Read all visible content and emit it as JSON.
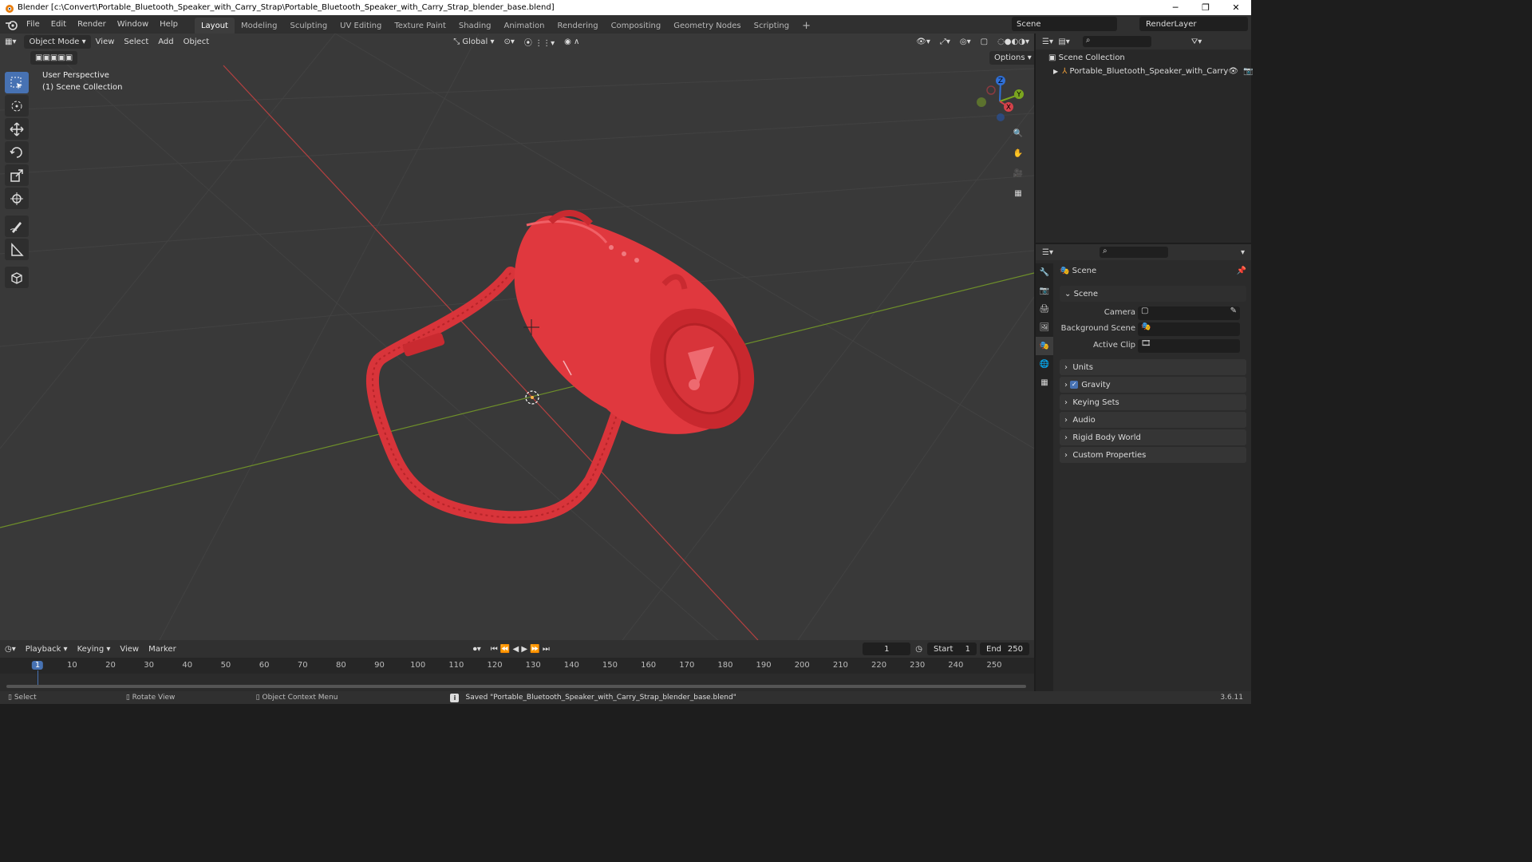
{
  "window": {
    "title": "Blender [c:\\Convert\\Portable_Bluetooth_Speaker_with_Carry_Strap\\Portable_Bluetooth_Speaker_with_Carry_Strap_blender_base.blend]",
    "min": "─",
    "max": "❐",
    "close": "✕"
  },
  "menus": [
    "File",
    "Edit",
    "Render",
    "Window",
    "Help"
  ],
  "workspaces": [
    "Layout",
    "Modeling",
    "Sculpting",
    "UV Editing",
    "Texture Paint",
    "Shading",
    "Animation",
    "Rendering",
    "Compositing",
    "Geometry Nodes",
    "Scripting"
  ],
  "scene_name": "Scene",
  "render_layer": "RenderLayer",
  "viewport": {
    "mode": "Object Mode",
    "menus": [
      "View",
      "Select",
      "Add",
      "Object"
    ],
    "transform": "Global",
    "options": "Options",
    "perspective": "User Perspective",
    "collection": "(1) Scene Collection",
    "gizmo": {
      "z": "Z",
      "y": "Y",
      "x": "X"
    },
    "object_color": "#e0383e"
  },
  "outliner": {
    "root": "Scene Collection",
    "object": "Portable_Bluetooth_Speaker_with_Carry"
  },
  "properties": {
    "header": "Scene",
    "section": "Scene",
    "fields": [
      {
        "label": "Camera"
      },
      {
        "label": "Background Scene"
      },
      {
        "label": "Active Clip"
      }
    ],
    "panels": [
      "Units",
      "Gravity",
      "Keying Sets",
      "Audio",
      "Rigid Body World",
      "Custom Properties"
    ]
  },
  "timeline": {
    "menus": [
      "Playback",
      "Keying",
      "View",
      "Marker"
    ],
    "current_frame": "1",
    "start_label": "Start",
    "start": "1",
    "end_label": "End",
    "end": "250",
    "ticks": [
      "1",
      "10",
      "20",
      "30",
      "40",
      "50",
      "60",
      "70",
      "80",
      "90",
      "100",
      "110",
      "120",
      "130",
      "140",
      "150",
      "160",
      "170",
      "180",
      "190",
      "200",
      "210",
      "220",
      "230",
      "240",
      "250"
    ]
  },
  "status": {
    "select": "Select",
    "rotate": "Rotate View",
    "context": "Object Context Menu",
    "message": "Saved \"Portable_Bluetooth_Speaker_with_Carry_Strap_blender_base.blend\"",
    "version": "3.6.11"
  }
}
